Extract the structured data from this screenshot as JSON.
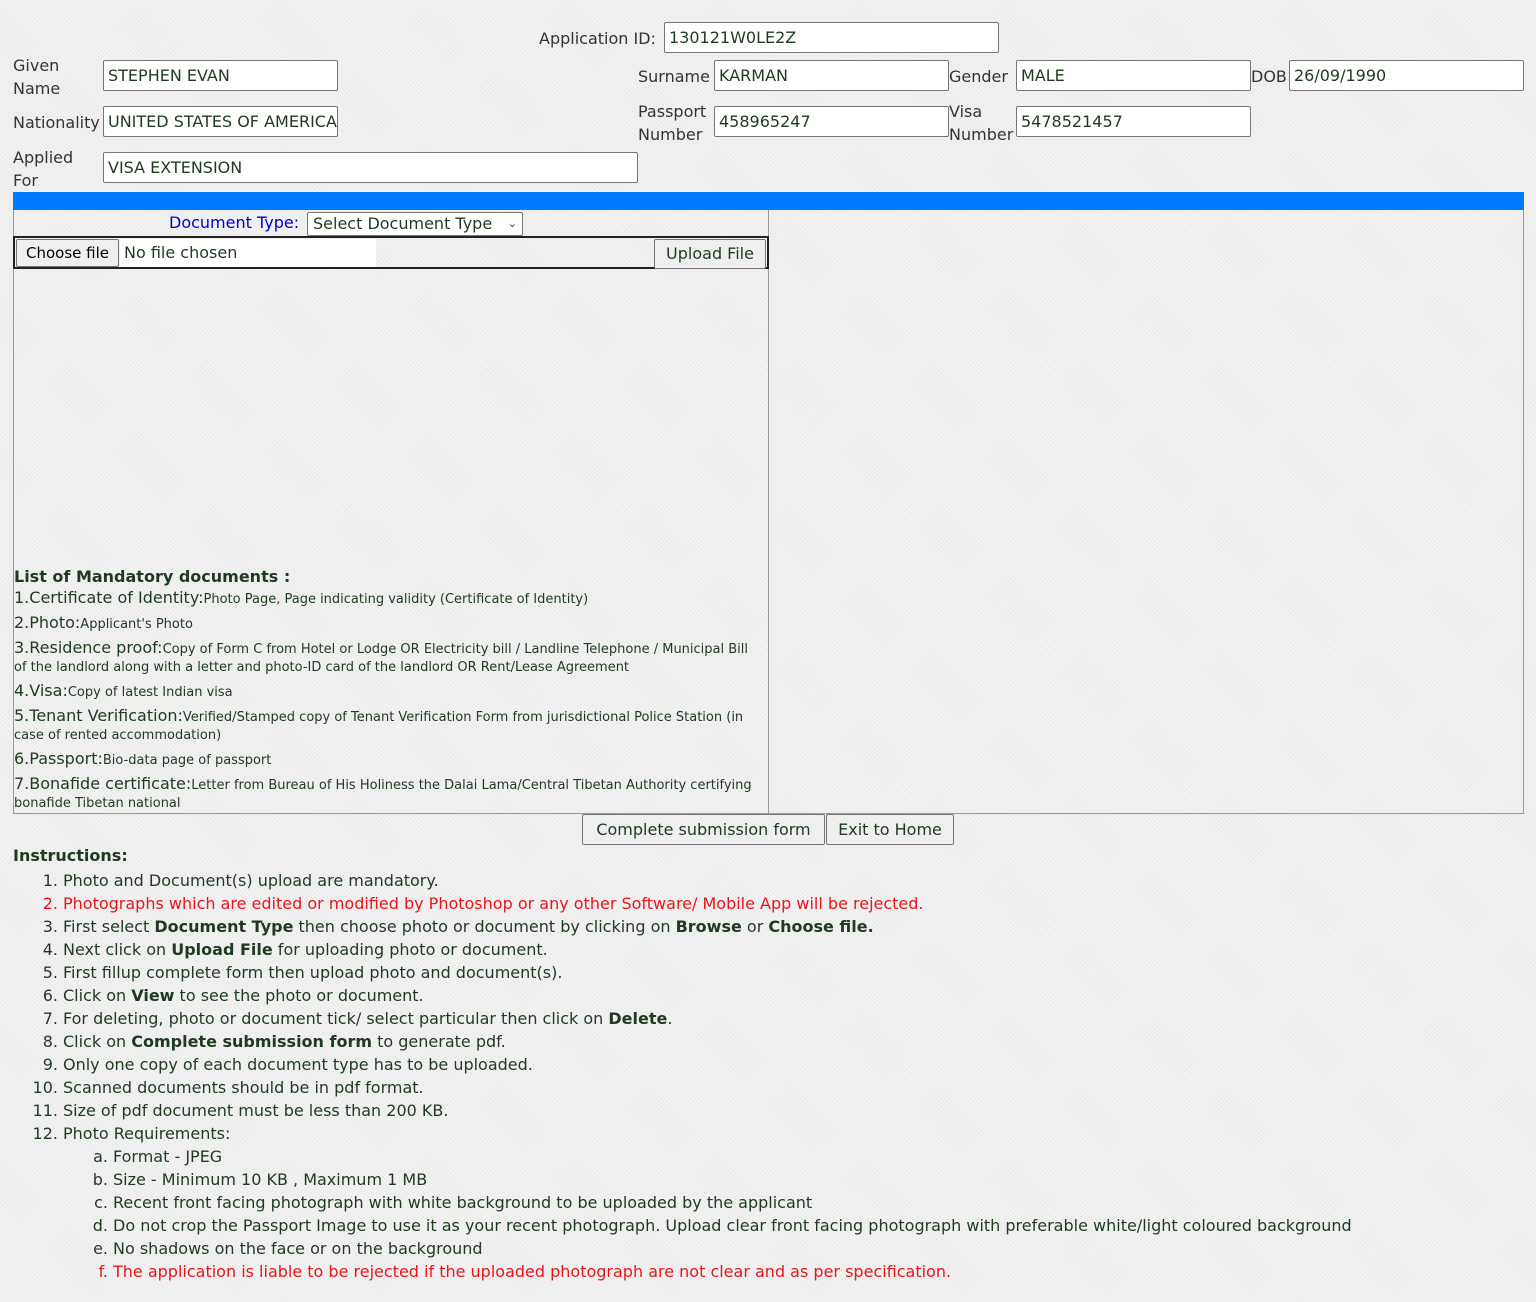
{
  "header": {
    "application_id_label": "Application ID:",
    "application_id_value": "130121W0LE2Z"
  },
  "fields": {
    "given_name_label": "Given Name",
    "given_name_value": "STEPHEN EVAN",
    "surname_label": "Surname",
    "surname_value": "KARMAN",
    "gender_label": "Gender",
    "gender_value": "MALE",
    "dob_label": "DOB",
    "dob_value": "26/09/1990",
    "nationality_label": "Nationality",
    "nationality_value": "UNITED STATES OF AMERICA",
    "passport_label": "Passport Number",
    "passport_value": "458965247",
    "visa_label": "Visa Number",
    "visa_value": "5478521457",
    "applied_for_label": "Applied For",
    "applied_for_value": "VISA EXTENSION"
  },
  "upload": {
    "doc_type_label": "Document Type:",
    "doc_type_selected": "Select Document Type",
    "choose_file_label": "Choose file",
    "no_file_text": "No file chosen",
    "upload_button": "Upload File"
  },
  "mandatory": {
    "title": "List of Mandatory documents :",
    "items": [
      {
        "head": "1.Certificate of Identity:",
        "desc": "Photo Page, Page indicating validity (Certificate of Identity)"
      },
      {
        "head": "2.Photo:",
        "desc": "Applicant's Photo"
      },
      {
        "head": "3.Residence proof:",
        "desc": "Copy of Form C from Hotel or Lodge OR Electricity bill / Landline Telephone / Municipal Bill of the landlord along with a letter and photo-ID card of the landlord OR Rent/Lease Agreement"
      },
      {
        "head": "4.Visa:",
        "desc": "Copy of latest Indian visa"
      },
      {
        "head": "5.Tenant Verification:",
        "desc": "Verified/Stamped copy of Tenant Verification Form from jurisdictional Police Station (in case of rented accommodation)"
      },
      {
        "head": "6.Passport:",
        "desc": "Bio-data page of passport"
      },
      {
        "head": "7.Bonafide certificate:",
        "desc": "Letter from Bureau of His Holiness the Dalai Lama/Central Tibetan Authority certifying bonafide Tibetan national"
      }
    ]
  },
  "actions": {
    "complete_button": "Complete submission form",
    "exit_button": "Exit to Home"
  },
  "instructions": {
    "title": "Instructions:",
    "items": [
      {
        "num": "1.",
        "parts": [
          {
            "t": "Photo and Document(s) upload are mandatory."
          }
        ]
      },
      {
        "num": "2.",
        "red": true,
        "parts": [
          {
            "t": "Photographs which are edited or modified by Photoshop or any other Software/ Mobile App will be rejected."
          }
        ]
      },
      {
        "num": "3.",
        "parts": [
          {
            "t": "First select "
          },
          {
            "t": "Document Type",
            "b": true
          },
          {
            "t": " then choose photo or document by clicking on "
          },
          {
            "t": "Browse",
            "b": true
          },
          {
            "t": " or "
          },
          {
            "t": "Choose file.",
            "b": true
          }
        ]
      },
      {
        "num": "4.",
        "parts": [
          {
            "t": "Next click on "
          },
          {
            "t": "Upload File",
            "b": true
          },
          {
            "t": " for uploading photo or document."
          }
        ]
      },
      {
        "num": "5.",
        "parts": [
          {
            "t": "First fillup complete form then upload photo and document(s)."
          }
        ]
      },
      {
        "num": "6.",
        "parts": [
          {
            "t": "Click on "
          },
          {
            "t": "View",
            "b": true
          },
          {
            "t": " to see the photo or document."
          }
        ]
      },
      {
        "num": "7.",
        "parts": [
          {
            "t": "For deleting, photo or document tick/ select particular then click on "
          },
          {
            "t": "Delete",
            "b": true
          },
          {
            "t": "."
          }
        ]
      },
      {
        "num": "8.",
        "parts": [
          {
            "t": "Click on "
          },
          {
            "t": "Complete submission form",
            "b": true
          },
          {
            "t": " to generate pdf."
          }
        ]
      },
      {
        "num": "9.",
        "parts": [
          {
            "t": "Only one copy of each document type has to be uploaded."
          }
        ]
      },
      {
        "num": "10.",
        "parts": [
          {
            "t": "Scanned documents should be in pdf format."
          }
        ]
      },
      {
        "num": "11.",
        "parts": [
          {
            "t": "Size of pdf document must be less than 200 KB."
          }
        ]
      },
      {
        "num": "12.",
        "parts": [
          {
            "t": "Photo Requirements:"
          }
        ]
      }
    ],
    "photo_requirements": [
      {
        "num": "a.",
        "text": "Format - JPEG"
      },
      {
        "num": "b.",
        "text": "Size - Minimum 10 KB , Maximum 1 MB"
      },
      {
        "num": "c.",
        "text": "Recent front facing photograph with white background to be uploaded by the applicant"
      },
      {
        "num": "d.",
        "text": "Do not crop the Passport Image to use it as your recent photograph. Upload clear front facing photograph with preferable white/light coloured background"
      },
      {
        "num": "e.",
        "text": "No shadows on the face or on the background"
      },
      {
        "num": "f.",
        "text": "The application is liable to be rejected if the uploaded photograph are not clear and as per specification.",
        "red": true
      }
    ]
  },
  "colors": {
    "accent_bar": "#007bff",
    "warning_red": "#e8161b",
    "label_blue": "#0000cc"
  }
}
